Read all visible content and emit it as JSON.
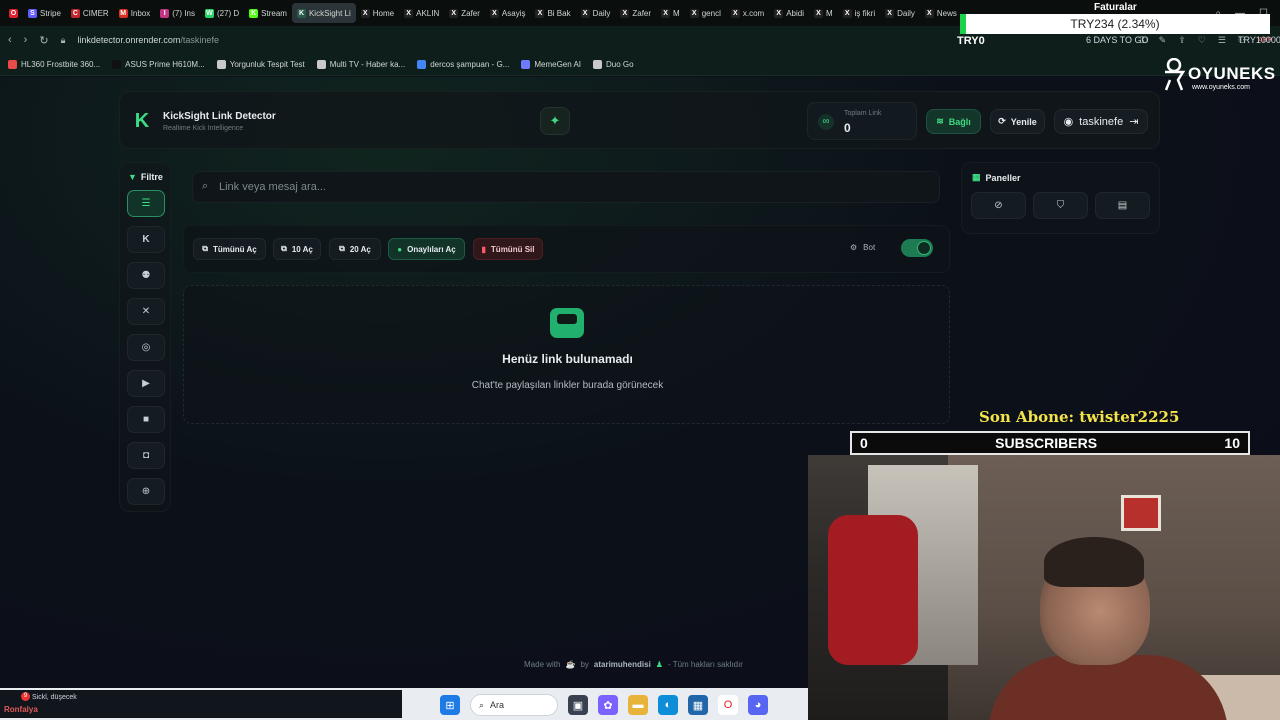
{
  "browser": {
    "tabs": [
      {
        "label": "Stripe",
        "color": "#635bff",
        "glyph": "S"
      },
      {
        "label": "CIMER",
        "color": "#c0262d",
        "glyph": "C"
      },
      {
        "label": "Inbox",
        "color": "#d93025",
        "glyph": "M"
      },
      {
        "label": "(7) Ins",
        "color": "#c13584",
        "glyph": "I"
      },
      {
        "label": "(27) D",
        "color": "#25d366",
        "glyph": "W"
      },
      {
        "label": "Stream",
        "color": "#53fc18",
        "glyph": "K"
      },
      {
        "label": "KickSight Li",
        "color": "#2a5a4a",
        "glyph": "K"
      },
      {
        "label": "Home",
        "color": "#222",
        "glyph": "X"
      },
      {
        "label": "AKLIN",
        "color": "#222",
        "glyph": "X"
      },
      {
        "label": "Zafer",
        "color": "#222",
        "glyph": "X"
      },
      {
        "label": "Asayiş",
        "color": "#222",
        "glyph": "X"
      },
      {
        "label": "Bi Bak",
        "color": "#222",
        "glyph": "X"
      },
      {
        "label": "Daily",
        "color": "#222",
        "glyph": "X"
      },
      {
        "label": "Zafer",
        "color": "#222",
        "glyph": "X"
      },
      {
        "label": "M",
        "color": "#222",
        "glyph": "X"
      },
      {
        "label": "gencl",
        "color": "#222",
        "glyph": "X"
      },
      {
        "label": "x.com",
        "color": "#222",
        "glyph": "X"
      },
      {
        "label": "Abidi",
        "color": "#222",
        "glyph": "X"
      },
      {
        "label": "M",
        "color": "#222",
        "glyph": "X"
      },
      {
        "label": "iş fikri",
        "color": "#222",
        "glyph": "X"
      },
      {
        "label": "Daily",
        "color": "#222",
        "glyph": "X"
      },
      {
        "label": "News",
        "color": "#222",
        "glyph": "X"
      }
    ],
    "url_host": "linkdetector.onrender.com",
    "url_path": "/taskinefe",
    "bookmarks": [
      {
        "label": "HL360 Frostbite 360...",
        "color": "#e94b4b"
      },
      {
        "label": "ASUS Prime H610M...",
        "color": "#111"
      },
      {
        "label": "Yorgunluk Tespit Test",
        "color": "#c9c9c9"
      },
      {
        "label": "Multi TV - Haber ka...",
        "color": "#c9c9c9"
      },
      {
        "label": "dercos şampuan - G...",
        "color": "#4285f4"
      },
      {
        "label": "MemeGen AI",
        "color": "#6d7cff"
      },
      {
        "label": "Duo Go",
        "color": "#c9c9c9"
      }
    ]
  },
  "overlay": {
    "ticker_title": "Faturalar",
    "ticker_text": "TRY234 (2.34%)",
    "try_left": "TRY0",
    "days_to_go": "6 DAYS TO GO",
    "try_right": "TRY10000",
    "brand": "OYUNEKS",
    "brand_url": "www.oyuneks.com",
    "last_sub": "Son Abone: twister2225",
    "sub_current": "0",
    "sub_label": "SUBSCRIBERS",
    "sub_goal": "10"
  },
  "app": {
    "brand_title": "KickSight Link Detector",
    "brand_sub": "Realtime Kick Intelligence",
    "stat_label": "Toplam Link",
    "stat_value": "0",
    "connected_label": "Bağlı",
    "refresh_label": "Yenile",
    "username": "taskinefe",
    "filter_title": "Filtre",
    "search_placeholder": "Link veya mesaj ara...",
    "panels_title": "Paneller",
    "actions": {
      "open_all": "Tümünü Aç",
      "open_10": "10 Aç",
      "open_20": "20 Aç",
      "open_approved": "Onaylıları Aç",
      "delete_all": "Tümünü Sil"
    },
    "bot_label": "Bot",
    "bot_enabled": true,
    "empty_title": "Henüz link bulunamadı",
    "empty_sub": "Chat'te paylaşılan linkler burada görünecek",
    "footer_made": "Made with",
    "footer_by": "by",
    "footer_author": "atarimuhendisi",
    "footer_rights": "- Tüm hakları saklıdır"
  },
  "taskbar": {
    "chat_line1": "Sickl, düşecek",
    "chat_line2": "Ronfalya",
    "badge": "9",
    "search_label": "Ara"
  }
}
